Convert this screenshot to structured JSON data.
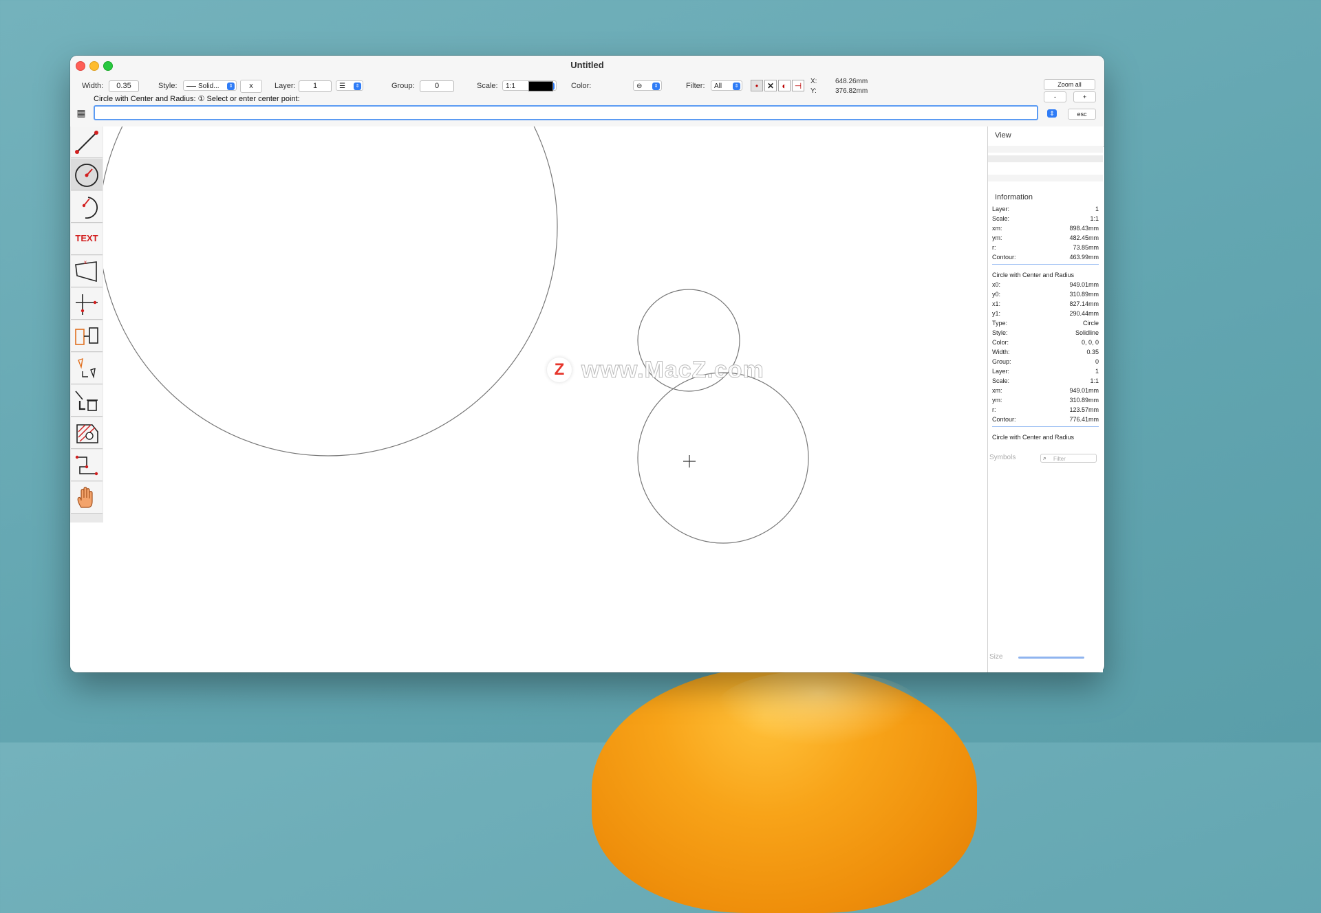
{
  "window": {
    "title": "Untitled"
  },
  "toolbar": {
    "width_label": "Width:",
    "width_value": "0.35",
    "style_label": "Style:",
    "style_value": "Solid...",
    "style_clear": "x",
    "layer_label": "Layer:",
    "layer_value": "1",
    "group_label": "Group:",
    "group_value": "0",
    "scale_label": "Scale:",
    "scale_value": "1:1",
    "color_label": "Color:",
    "color_value": "#000000",
    "filter_label": "Filter:",
    "filter_value": "All",
    "coords": {
      "x_label": "X:",
      "x_value": "648.26mm",
      "y_label": "Y:",
      "y_value": "376.82mm"
    },
    "zoom_all": "Zoom all",
    "zoom_minus": "-",
    "zoom_plus": "+",
    "esc": "esc"
  },
  "command": {
    "prompt": "Circle with Center and Radius: ① Select or enter center point:",
    "input_value": ""
  },
  "tools": [
    {
      "name": "line-tool"
    },
    {
      "name": "circle-tool"
    },
    {
      "name": "arc-tool"
    },
    {
      "name": "text-tool",
      "label": "TEXT"
    },
    {
      "name": "dimension-tool"
    },
    {
      "name": "snap-tool"
    },
    {
      "name": "copy-tool"
    },
    {
      "name": "modify-tool"
    },
    {
      "name": "delete-tool"
    },
    {
      "name": "hatch-tool"
    },
    {
      "name": "polyline-tool"
    },
    {
      "name": "pan-tool"
    }
  ],
  "watermark": {
    "logo": "Z",
    "text": "www.MacZ.com"
  },
  "right_panel": {
    "view_title": "View",
    "info_title": "Information",
    "info_block1": [
      {
        "k": "Layer:",
        "v": "1"
      },
      {
        "k": "Scale:",
        "v": "1:1"
      },
      {
        "k": "xm:",
        "v": "898.43mm"
      },
      {
        "k": "ym:",
        "v": "482.45mm"
      },
      {
        "k": "r:",
        "v": "73.85mm"
      },
      {
        "k": "Contour:",
        "v": "463.99mm"
      }
    ],
    "info_block2_title": "Circle with Center and Radius",
    "info_block2": [
      {
        "k": "x0:",
        "v": "949.01mm"
      },
      {
        "k": "y0:",
        "v": "310.89mm"
      },
      {
        "k": "x1:",
        "v": "827.14mm"
      },
      {
        "k": "y1:",
        "v": "290.44mm"
      },
      {
        "k": "Type:",
        "v": "Circle"
      },
      {
        "k": "Style:",
        "v": "Solidline"
      },
      {
        "k": "Color:",
        "v": "0, 0, 0"
      },
      {
        "k": "Width:",
        "v": "0.35"
      },
      {
        "k": "Group:",
        "v": "0"
      },
      {
        "k": "Layer:",
        "v": "1"
      },
      {
        "k": "Scale:",
        "v": "1:1"
      },
      {
        "k": "xm:",
        "v": "949.01mm"
      },
      {
        "k": "ym:",
        "v": "310.89mm"
      },
      {
        "k": "r:",
        "v": "123.57mm"
      },
      {
        "k": "Contour:",
        "v": "776.41mm"
      }
    ],
    "info_block3_title": "Circle with Center and Radius",
    "symbols_label": "Symbols",
    "filter_placeholder": "Filter",
    "size_label": "Size"
  }
}
